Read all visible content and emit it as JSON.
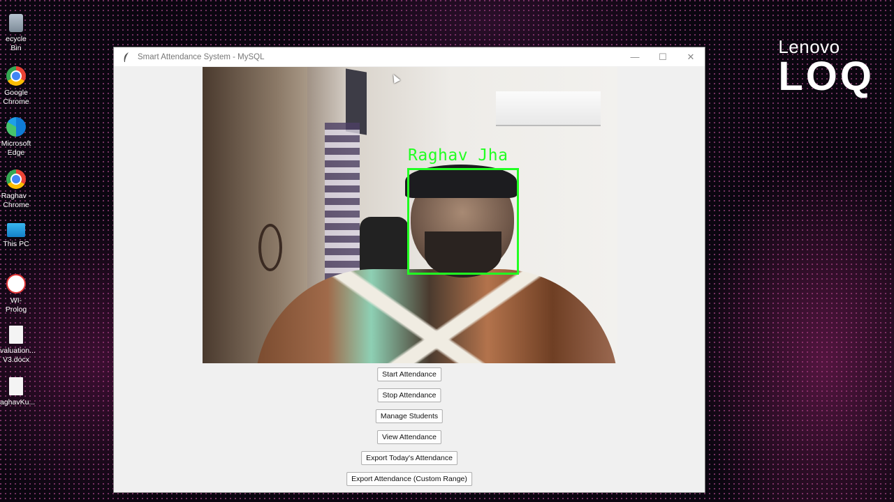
{
  "desktop": {
    "icons": [
      {
        "label": "ecycle Bin",
        "icon": "recycle-bin-icon"
      },
      {
        "label": "Google Chrome",
        "icon": "chrome-icon"
      },
      {
        "label": "Microsoft Edge",
        "icon": "edge-icon"
      },
      {
        "label": "Raghav - Chrome",
        "icon": "chrome-icon"
      },
      {
        "label": "This PC",
        "icon": "computer-icon"
      },
      {
        "label": "WI-Prolog",
        "icon": "prolog-icon"
      },
      {
        "label": "valuation... V3.docx",
        "icon": "document-icon"
      },
      {
        "label": "aghavKu...",
        "icon": "document-icon"
      }
    ],
    "brand": {
      "top": "Lenovo",
      "main": "LOQ"
    }
  },
  "window": {
    "title": "Smart Attendance System - MySQL",
    "controls": {
      "minimize": "—",
      "maximize": "☐",
      "close": "✕"
    },
    "camera": {
      "detected_name": "Raghav Jha",
      "box_color": "#22ff22"
    },
    "buttons": {
      "start": "Start Attendance",
      "stop": "Stop Attendance",
      "manage": "Manage Students",
      "view": "View Attendance",
      "export_today": "Export Today's Attendance",
      "export_range": "Export Attendance (Custom Range)"
    }
  }
}
